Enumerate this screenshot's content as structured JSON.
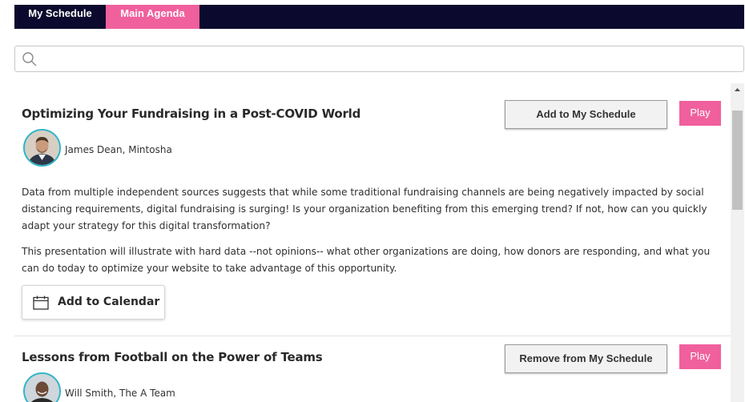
{
  "tabs": [
    {
      "label": "My Schedule",
      "active": false
    },
    {
      "label": "Main Agenda",
      "active": true
    }
  ],
  "search": {
    "placeholder": "",
    "value": "",
    "icon": "search-icon"
  },
  "sessions": [
    {
      "title": "Optimizing Your Fundraising in a Post-COVID World",
      "schedule_button": "Add to My Schedule",
      "play_button": "Play",
      "speaker": "James Dean, Mintosha",
      "description": [
        "Data from multiple independent sources suggests that while some traditional fundraising channels are being negatively impacted by social distancing requirements, digital fundraising is surging!  Is your organization benefiting from this emerging trend?  If not, how can you quickly adapt your strategy for this digital transformation?",
        "This presentation will illustrate with hard data --not opinions-- what other organizations are doing, how donors are responding, and what you can do today to optimize your website to take advantage of this opportunity."
      ],
      "calendar_button": "Add to Calendar"
    },
    {
      "title": "Lessons from Football on the Power of Teams",
      "schedule_button": "Remove from My Schedule",
      "play_button": "Play",
      "speaker": "Will Smith, The A Team"
    }
  ],
  "colors": {
    "tabbar_bg": "#0b0a2e",
    "accent_pink": "#f0609d",
    "avatar_ring": "#2fb5c8"
  }
}
